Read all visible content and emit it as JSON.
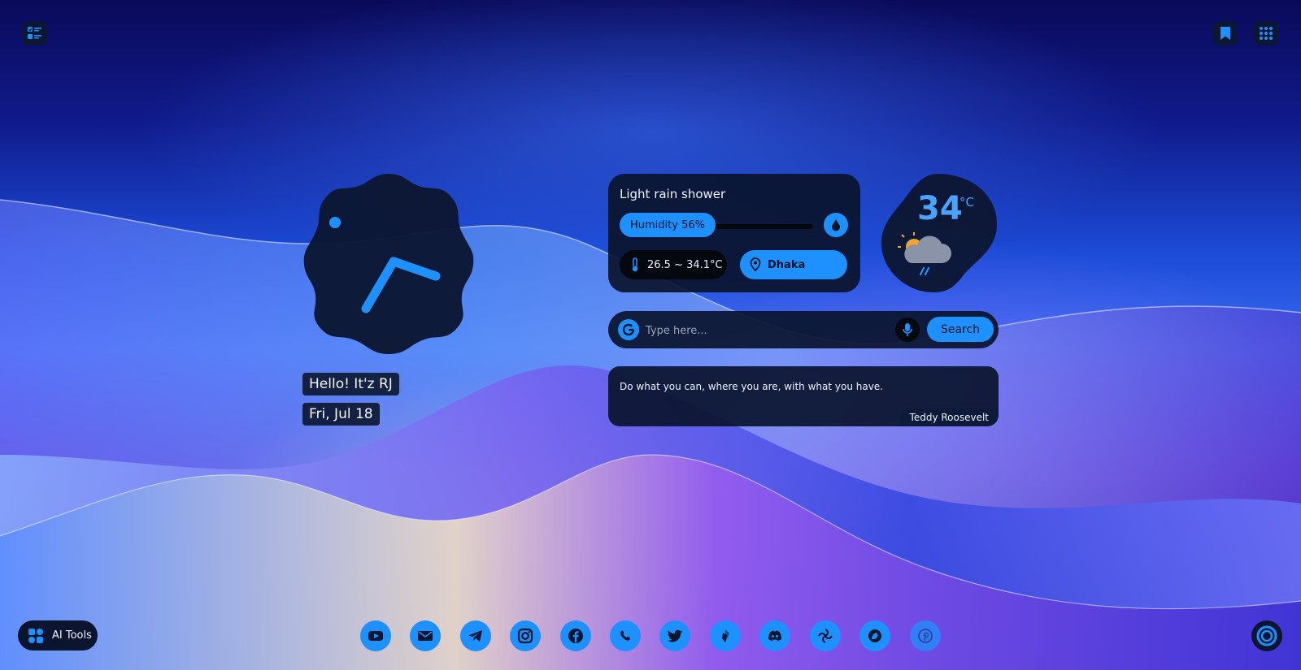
{
  "colors": {
    "accent": "#1e90ff",
    "card_bg": "#0a142d",
    "dark": "#05080f"
  },
  "greeting": {
    "hello": "Hello! It'z RJ",
    "date": "Fri, Jul 18"
  },
  "weather": {
    "condition": "Light rain shower",
    "humidity_label": "Humidity 56%",
    "humidity": 0.56,
    "temp_range": "26.5 ~ 34.1°C",
    "location": "Dhaka",
    "temp": "34",
    "unit": "°C",
    "icon": "partly-cloudy-rain-icon"
  },
  "search": {
    "placeholder": "Type here...",
    "button": "Search",
    "engine_icon": "google-icon",
    "voice_icon": "microphone-icon"
  },
  "quote": {
    "text": "Do what you can, where you are, with what you have.",
    "author": "Teddy Roosevelt"
  },
  "ai_tools": {
    "label": "AI Tools"
  },
  "top_icons": [
    "todo-list-icon",
    "bookmark-icon",
    "apps-grid-icon"
  ],
  "dock": [
    "youtube-icon",
    "mail-icon",
    "telegram-icon",
    "instagram-icon",
    "facebook-icon",
    "whatsapp-icon",
    "twitter-icon",
    "bluesky-icon",
    "discord-icon",
    "deepseek-icon",
    "ai-assistant-icon",
    "pinterest-icon"
  ]
}
